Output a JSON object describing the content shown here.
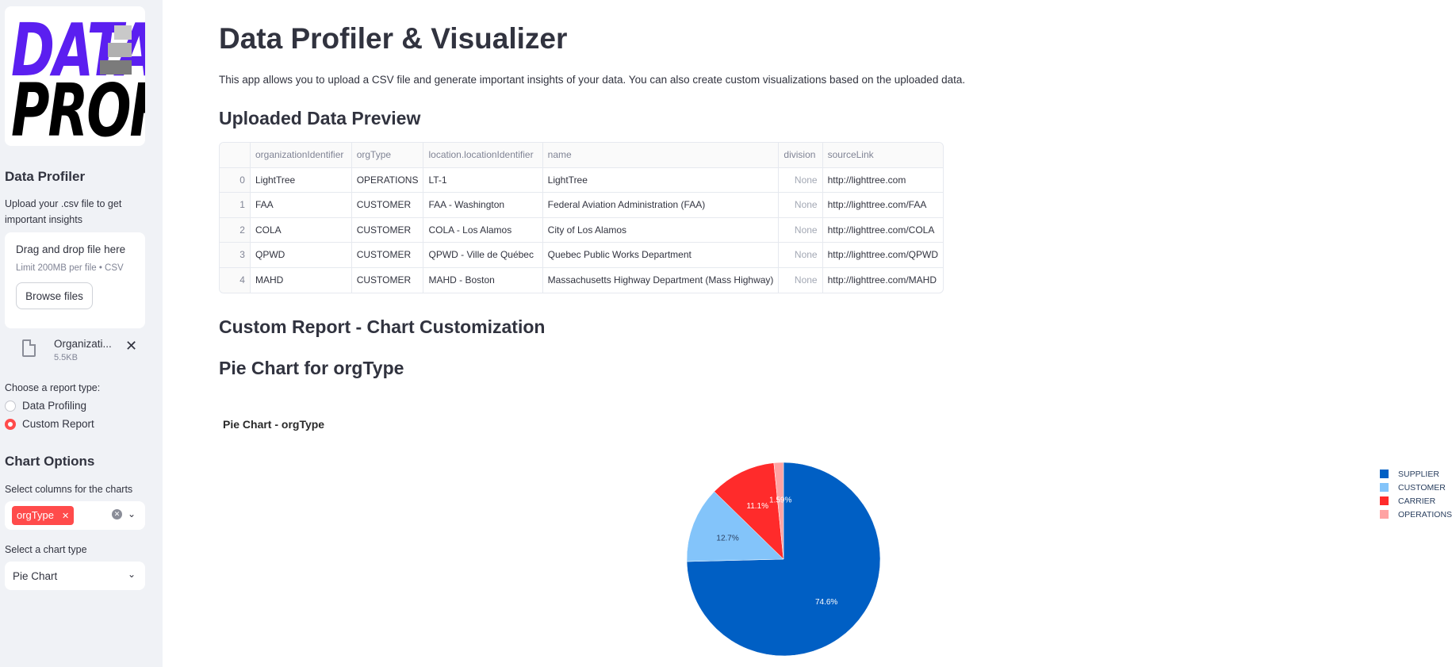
{
  "sidebar": {
    "logo_line1": "DATA",
    "logo_line2": "PROFILER",
    "app_title": "Data Profiler",
    "upload_hint": "Upload your .csv file to get important insights",
    "uploader": {
      "title": "Drag and drop file here",
      "limit": "Limit 200MB per file • CSV",
      "button": "Browse files"
    },
    "file": {
      "name": "Organizati...",
      "size": "5.5KB",
      "icon": "file-icon"
    },
    "report_label": "Choose a report type:",
    "report_options": [
      {
        "label": "Data Profiling",
        "selected": false
      },
      {
        "label": "Custom Report",
        "selected": true
      }
    ],
    "chart_options_title": "Chart Options",
    "columns_label": "Select columns for the charts",
    "selected_column": "orgType",
    "chart_type_label": "Select a chart type",
    "chart_type_value": "Pie Chart"
  },
  "main": {
    "title": "Data Profiler & Visualizer",
    "intro": "This app allows you to upload a CSV file and generate important insights of your data. You can also create custom visualizations based on the uploaded data.",
    "preview_heading": "Uploaded Data Preview",
    "table": {
      "columns": [
        "",
        "organizationIdentifier",
        "orgType",
        "location.locationIdentifier",
        "name",
        "division",
        "sourceLink"
      ],
      "rows": [
        [
          "0",
          "LightTree",
          "OPERATIONS",
          "LT-1",
          "LightTree",
          "None",
          "http://lighttree.com"
        ],
        [
          "1",
          "FAA",
          "CUSTOMER",
          "FAA - Washington",
          "Federal Aviation Administration (FAA)",
          "None",
          "http://lighttree.com/FAA"
        ],
        [
          "2",
          "COLA",
          "CUSTOMER",
          "COLA - Los Alamos",
          "City of Los Alamos",
          "None",
          "http://lighttree.com/COLA"
        ],
        [
          "3",
          "QPWD",
          "CUSTOMER",
          "QPWD - Ville de Québec",
          "Quebec Public Works Department",
          "None",
          "http://lighttree.com/QPWD"
        ],
        [
          "4",
          "MAHD",
          "CUSTOMER",
          "MAHD - Boston",
          "Massachusetts Highway Department (Mass Highway)",
          "None",
          "http://lighttree.com/MAHD"
        ]
      ]
    },
    "custom_heading": "Custom Report - Chart Customization",
    "pie_heading": "Pie Chart for orgType"
  },
  "chart_data": {
    "type": "pie",
    "title": "Pie Chart - orgType",
    "legend_position": "top-right",
    "slices": [
      {
        "label": "SUPPLIER",
        "value": 74.6,
        "text": "74.6%",
        "color": "#005fc4"
      },
      {
        "label": "CUSTOMER",
        "value": 12.7,
        "text": "12.7%",
        "color": "#83c4fa"
      },
      {
        "label": "CARRIER",
        "value": 11.1,
        "text": "11.1%",
        "color": "#ff2b2b"
      },
      {
        "label": "OPERATIONS",
        "value": 1.59,
        "text": "1.59%",
        "color": "#ffa3a3"
      }
    ]
  }
}
